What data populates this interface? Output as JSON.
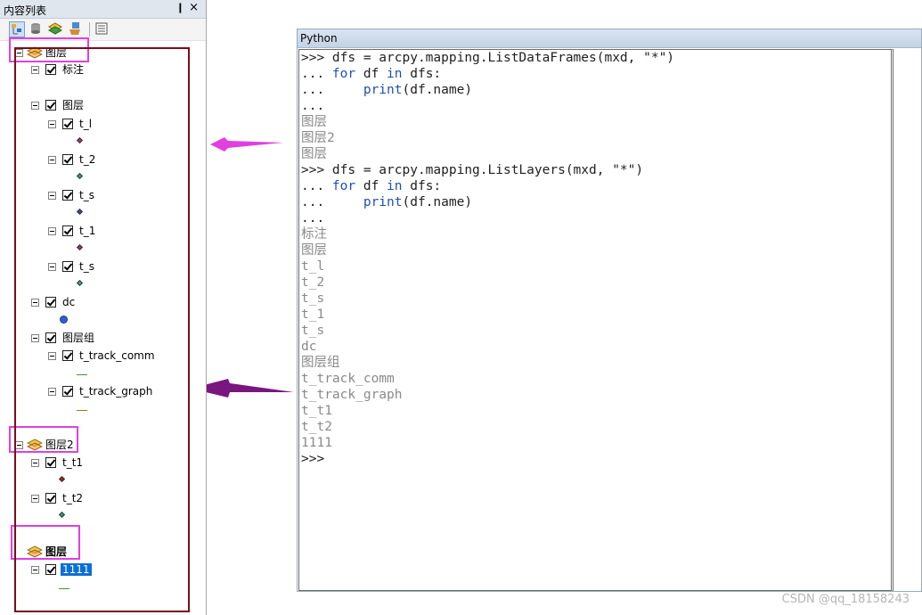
{
  "toc": {
    "title": "内容列表",
    "pin_glyph": "❙",
    "close_glyph": "×",
    "toolbar": [
      "list-by-drawing-order-icon",
      "list-by-source-icon",
      "list-by-visibility-icon",
      "list-by-selection-icon",
      "options-icon"
    ],
    "frame1": {
      "name": "图层"
    },
    "items": {
      "biaozhu": "标注",
      "tuceng": "图层",
      "t_l": "t_l",
      "t_2": "t_2",
      "t_s_a": "t_s",
      "t_1": "t_1",
      "t_s_b": "t_s",
      "dc": "dc",
      "group": "图层组",
      "track_comm": "t_track_comm",
      "track_graph": "t_track_graph"
    },
    "frame2": {
      "name": "图层2",
      "items": {
        "t_t1": "t_t1",
        "t_t2": "t_t2"
      }
    },
    "frame3": {
      "name": "图层",
      "items": {
        "l1111": "1111"
      }
    },
    "colors": {
      "annotation_magenta": "#e040e0",
      "annotation_darkred": "#7a0d18",
      "arrow_purple": "#7a1680",
      "selection_blue": "#0a6fd6"
    }
  },
  "python": {
    "title": "Python",
    "lines": [
      {
        "p": ">>> ",
        "c": "dfs = arcpy.mapping.ListDataFrames(mxd, \"*\")"
      },
      {
        "p": "... ",
        "kw1": "for",
        "m": " df ",
        "kw2": "in",
        "e": " dfs:"
      },
      {
        "p": "...     ",
        "kw1": "print",
        "e": "(df.name)"
      },
      {
        "p": "...",
        "c": ""
      },
      {
        "out": "图层"
      },
      {
        "out": "图层2"
      },
      {
        "out": "图层"
      },
      {
        "p": ">>> ",
        "c": "dfs = arcpy.mapping.ListLayers(mxd, \"*\")"
      },
      {
        "p": "... ",
        "kw1": "for",
        "m": " df ",
        "kw2": "in",
        "e": " dfs:"
      },
      {
        "p": "...     ",
        "kw1": "print",
        "e": "(df.name)"
      },
      {
        "p": "...",
        "c": ""
      },
      {
        "out": "标注"
      },
      {
        "out": "图层"
      },
      {
        "out": "t_l"
      },
      {
        "out": "t_2"
      },
      {
        "out": "t_s"
      },
      {
        "out": "t_1"
      },
      {
        "out": "t_s"
      },
      {
        "out": "dc"
      },
      {
        "out": "图层组"
      },
      {
        "out": "t_track_comm"
      },
      {
        "out": "t_track_graph"
      },
      {
        "out": "t_t1"
      },
      {
        "out": "t_t2"
      },
      {
        "out": "1111"
      },
      {
        "p": ">>>",
        "c": ""
      }
    ]
  },
  "watermark": "CSDN @qq_18158243"
}
